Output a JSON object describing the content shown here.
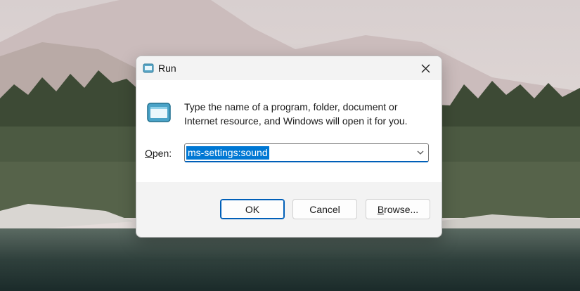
{
  "dialog": {
    "title": "Run",
    "description": "Type the name of a program, folder, document or Internet resource, and Windows will open it for you.",
    "open_label_key": "O",
    "open_label_rest": "pen:",
    "command_value": "ms-settings:sound",
    "buttons": {
      "ok": "OK",
      "cancel": "Cancel",
      "browse_key": "B",
      "browse_rest": "rowse..."
    }
  },
  "icons": {
    "title": "run-app-icon",
    "large": "run-app-icon",
    "close": "close-icon",
    "dropdown": "chevron-down-icon"
  },
  "colors": {
    "accent": "#005fb8",
    "selection": "#0078d4",
    "dialog_bg": "#f3f3f3",
    "content_bg": "#ffffff"
  }
}
